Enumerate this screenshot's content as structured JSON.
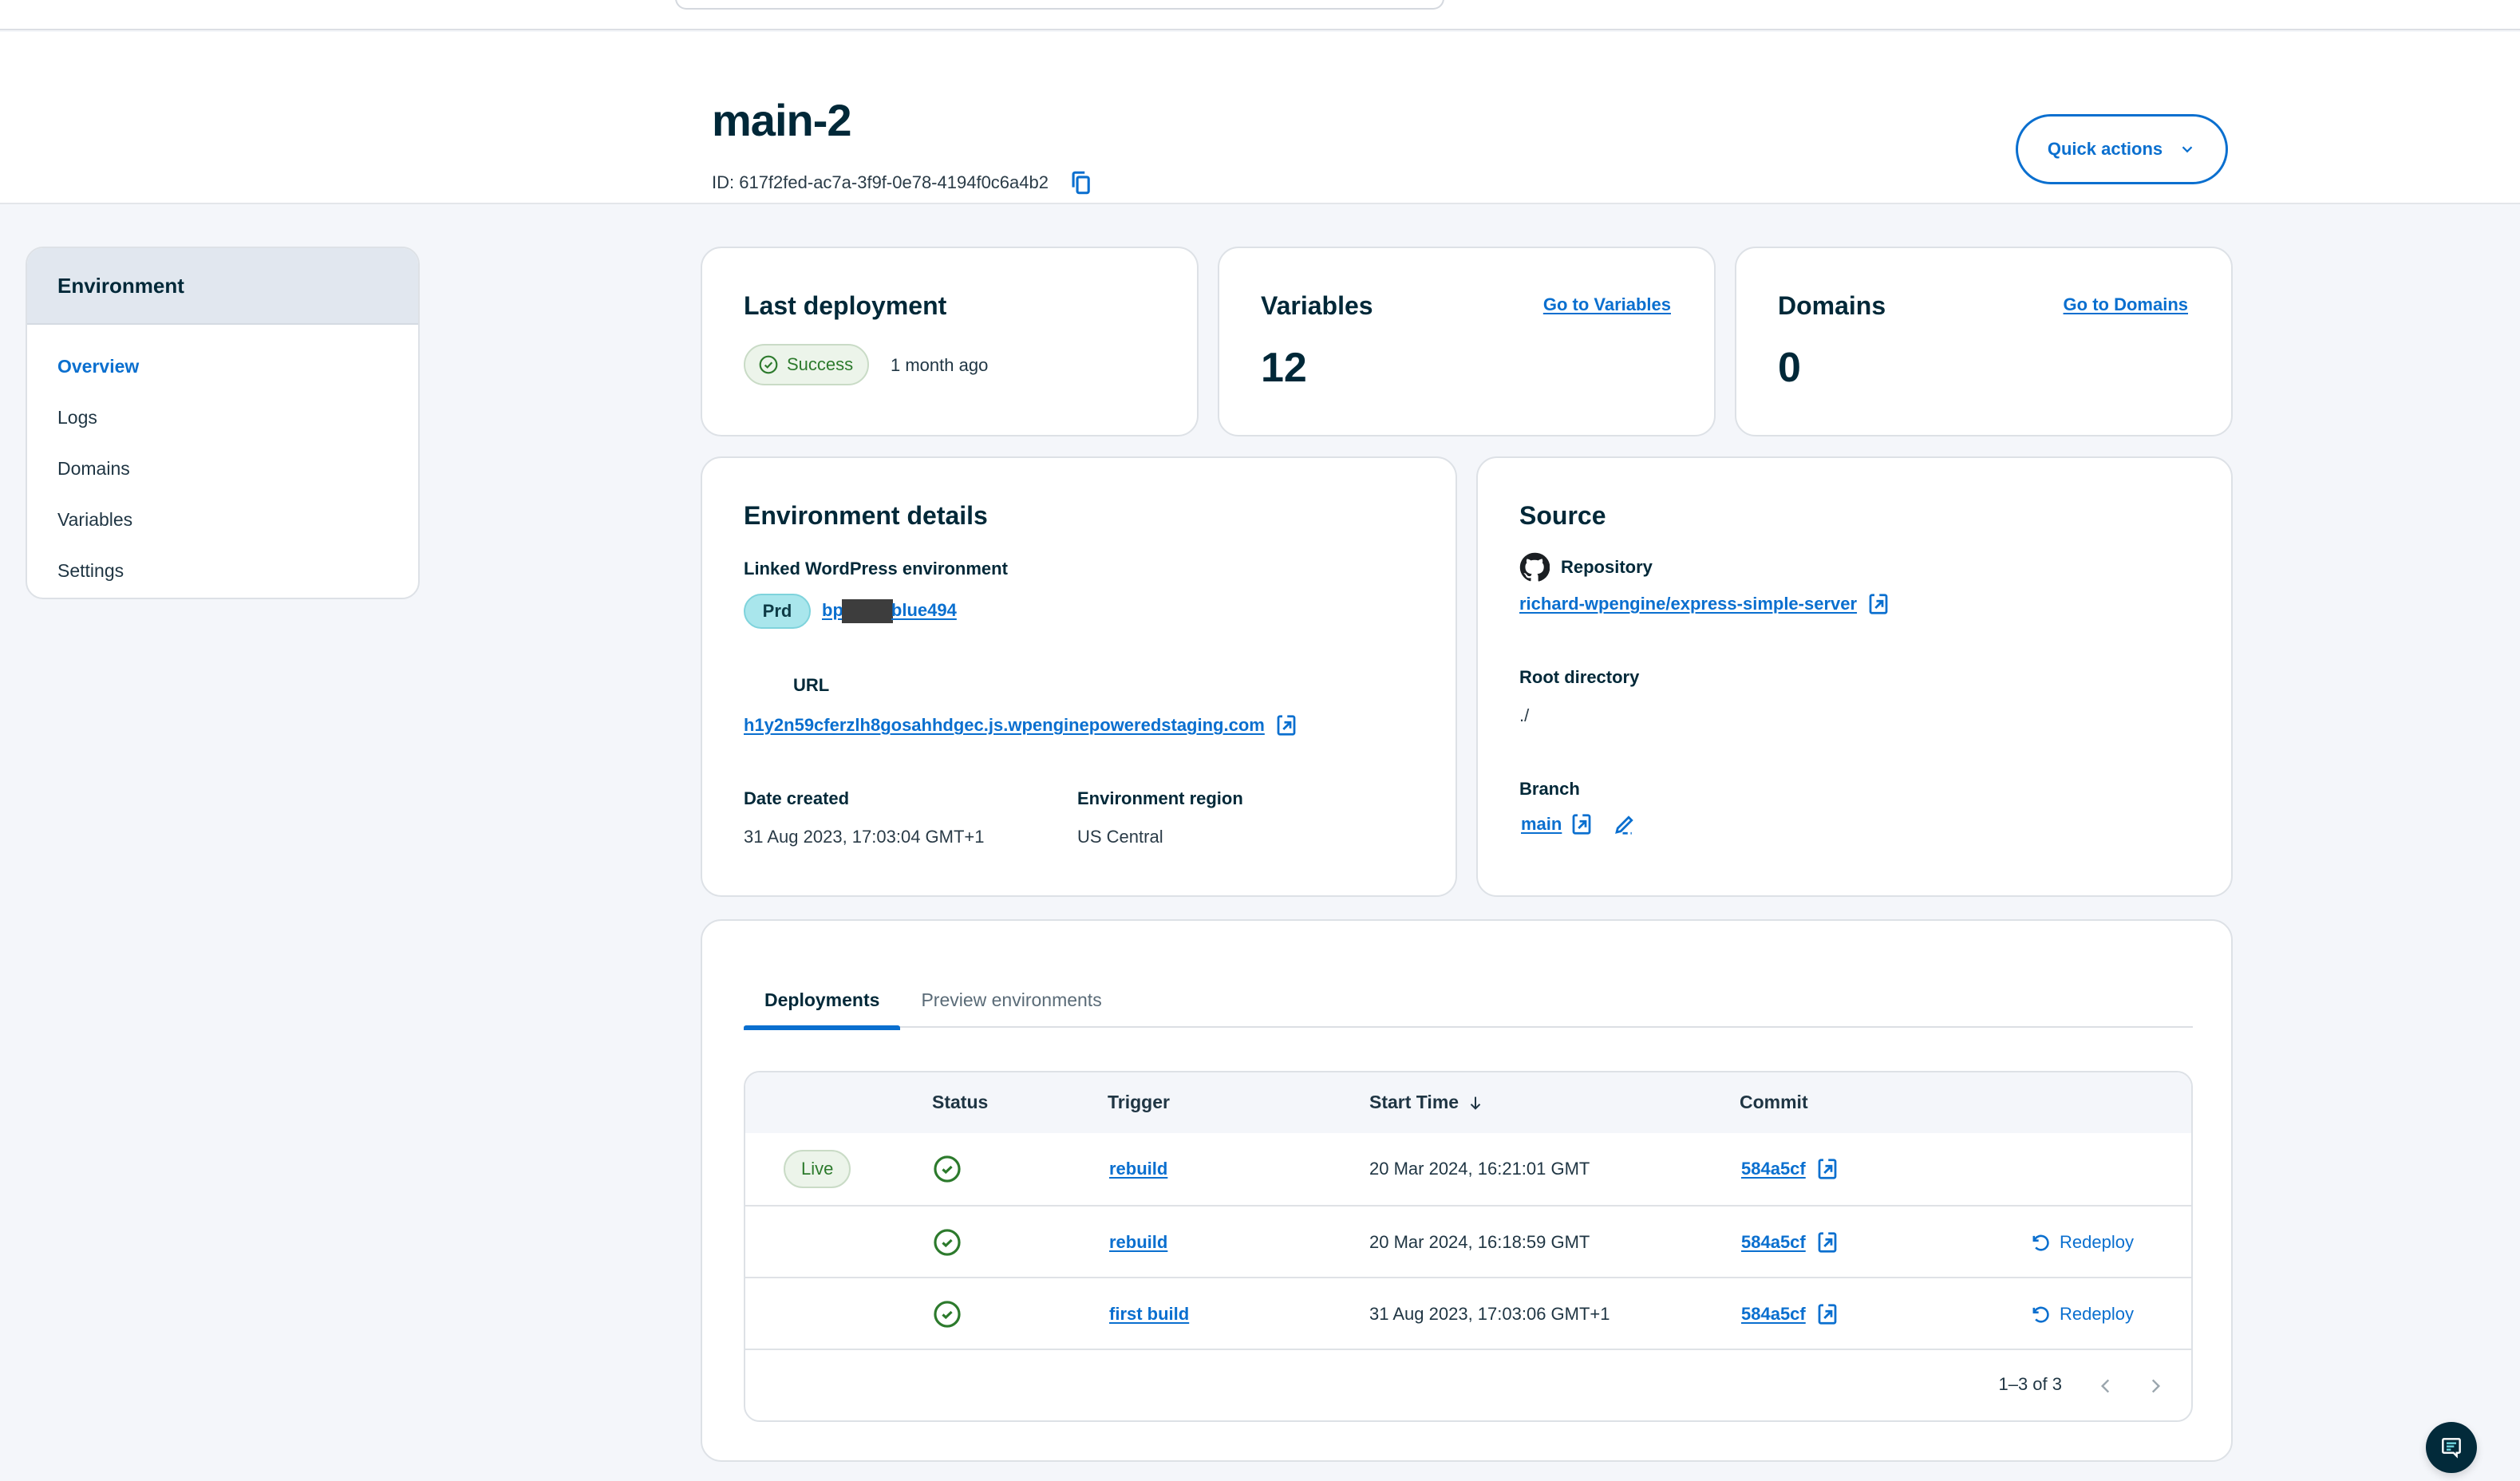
{
  "header": {
    "title": "main-2",
    "id_text": "ID: 617f2fed-ac7a-3f9f-0e78-4194f0c6a4b2",
    "quick_actions_label": "Quick actions"
  },
  "sidebar": {
    "heading": "Environment",
    "items": [
      {
        "label": "Overview",
        "active": true
      },
      {
        "label": "Logs"
      },
      {
        "label": "Domains"
      },
      {
        "label": "Variables"
      },
      {
        "label": "Settings"
      }
    ]
  },
  "last_deployment": {
    "title": "Last deployment",
    "status": "Success",
    "ago": "1 month ago"
  },
  "variables": {
    "title": "Variables",
    "link": "Go to Variables",
    "count": "12"
  },
  "domains": {
    "title": "Domains",
    "link": "Go to Domains",
    "count": "0"
  },
  "env_details": {
    "title": "Environment details",
    "linked_label": "Linked WordPress environment",
    "env_badge": "Prd",
    "env_name_prefix": "bp",
    "env_name_suffix": "blue494",
    "url_label": "URL",
    "url": "h1y2n59cferzlh8gosahhdgec.js.wpenginepoweredstaging.com",
    "date_label": "Date created",
    "date_value": "31 Aug 2023, 17:03:04 GMT+1",
    "region_label": "Environment region",
    "region_value": "US Central"
  },
  "source": {
    "title": "Source",
    "repo_label": "Repository",
    "repo": "richard-wpengine/express-simple-server",
    "root_label": "Root directory",
    "root_value": "./",
    "branch_label": "Branch",
    "branch": "main"
  },
  "deployments": {
    "tabs": [
      {
        "label": "Deployments",
        "active": true
      },
      {
        "label": "Preview environments"
      }
    ],
    "columns": {
      "status": "Status",
      "trigger": "Trigger",
      "start_time": "Start Time",
      "commit": "Commit"
    },
    "rows": [
      {
        "badge": "Live",
        "status": "success",
        "trigger": "rebuild",
        "start": "20 Mar 2024, 16:21:01 GMT",
        "commit": "584a5cf",
        "action": ""
      },
      {
        "badge": "",
        "status": "success",
        "trigger": "rebuild",
        "start": "20 Mar 2024, 16:18:59 GMT",
        "commit": "584a5cf",
        "action": "Redeploy"
      },
      {
        "badge": "",
        "status": "success",
        "trigger": "first build",
        "start": "31 Aug 2023, 17:03:06 GMT+1",
        "commit": "584a5cf",
        "action": "Redeploy"
      }
    ],
    "pagination": "1–3 of 3"
  },
  "colors": {
    "accent": "#0a6fcf",
    "success": "#2c7a2c",
    "text": "#002838",
    "background": "#f4f6fa"
  }
}
